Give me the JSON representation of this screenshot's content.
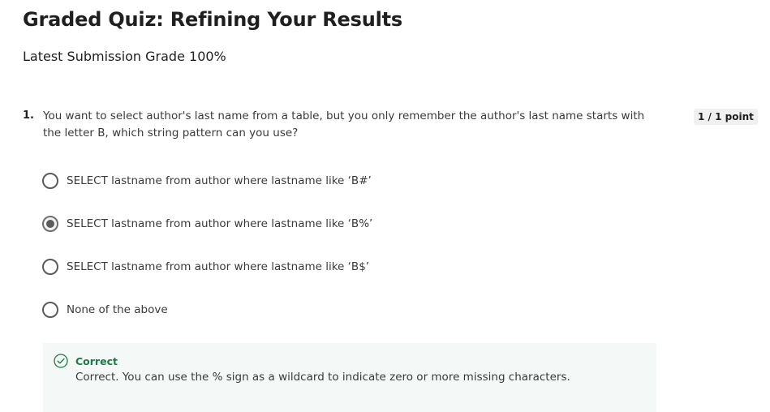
{
  "header": {
    "title": "Graded Quiz: Refining Your Results",
    "grade": "Latest Submission Grade 100%"
  },
  "question": {
    "number": "1.",
    "text": "You want to select author's last name from a table, but you only remember the author's last name starts with the letter B, which string pattern can you use?",
    "points": "1 / 1 point",
    "options": [
      {
        "label": "SELECT lastname from author where lastname like ‘B#’",
        "selected": false
      },
      {
        "label": "SELECT lastname from author where lastname like ‘B%’",
        "selected": true
      },
      {
        "label": "SELECT lastname from author where lastname like ‘B$’",
        "selected": false
      },
      {
        "label": "None of the above",
        "selected": false
      }
    ]
  },
  "feedback": {
    "icon": "check-circle-icon",
    "title": "Correct",
    "text": "Correct. You can use the % sign as a wildcard to indicate zero or more missing characters.",
    "color": "#1e7a46"
  }
}
